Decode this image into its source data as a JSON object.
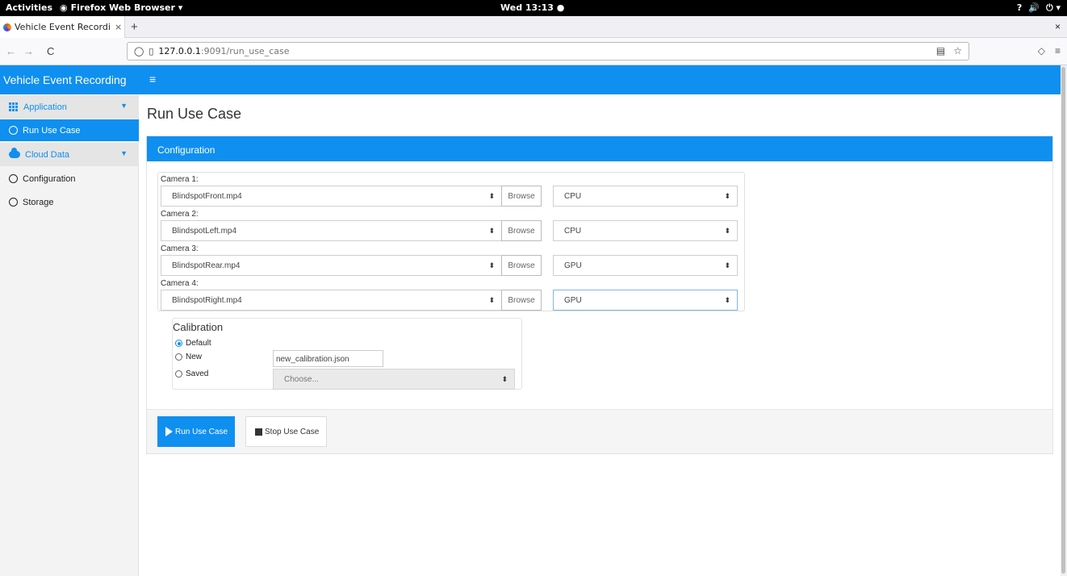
{
  "system_bar": {
    "activities": "Activities",
    "app_name": "Firefox Web Browser ▾",
    "clock": "Wed 13:13 ●",
    "tray": [
      "?",
      "🔊",
      "⏻ ▾"
    ]
  },
  "browser": {
    "tab_title": "Vehicle Event Recordi",
    "tab_close": "×",
    "new_tab": "+",
    "window_close": "×",
    "back": "←",
    "forward": "→",
    "reload": "C",
    "url_host": "127.0.0.1",
    "url_path": ":9091/run_use_case",
    "reader_icon": "▤",
    "bookmark_icon": "☆",
    "pocket_icon": "◇",
    "menu_icon": "≡"
  },
  "app": {
    "brand": "Vehicle Event Recording",
    "menu_toggle": "≡",
    "sidebar": {
      "application_label": "Application",
      "run_use_case_label": "Run Use Case",
      "cloud_data_label": "Cloud Data",
      "configuration_label": "Configuration",
      "storage_label": "Storage"
    },
    "page_title": "Run Use Case",
    "panel_title": "Configuration",
    "cameras": [
      {
        "label": "Camera 1:",
        "file": "BlindspotFront.mp4",
        "device": "CPU"
      },
      {
        "label": "Camera 2:",
        "file": "BlindspotLeft.mp4",
        "device": "CPU"
      },
      {
        "label": "Camera 3:",
        "file": "BlindspotRear.mp4",
        "device": "GPU"
      },
      {
        "label": "Camera 4:",
        "file": "BlindspotRight.mp4",
        "device": "GPU"
      }
    ],
    "browse_label": "Browse",
    "select_arrow": "⬍",
    "calibration": {
      "title": "Calibration",
      "default_label": "Default",
      "new_label": "New",
      "saved_label": "Saved",
      "new_filename": "new_calibration.json",
      "saved_placeholder": "Choose...",
      "selected": "Default"
    },
    "run_button": "Run Use Case",
    "stop_button": "Stop Use Case"
  }
}
